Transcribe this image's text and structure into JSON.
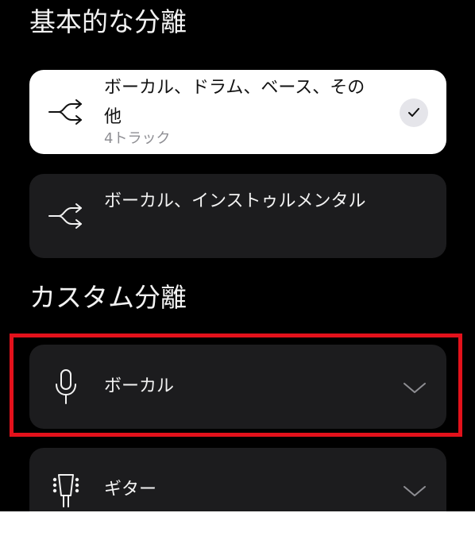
{
  "sections": {
    "basic": {
      "title": "基本的な分離"
    },
    "custom": {
      "title": "カスタム分離"
    }
  },
  "basic_options": [
    {
      "title": "ボーカル、ドラム、ベース、その他",
      "subtitle": "4トラック",
      "selected": true,
      "icon": "split-arrows-icon"
    },
    {
      "title": "ボーカル、インストゥルメンタル",
      "selected": false,
      "icon": "split-arrows-icon"
    }
  ],
  "custom_options": [
    {
      "label": "ボーカル",
      "icon": "microphone-icon",
      "expand_icon": "chevron-down-icon"
    },
    {
      "label": "ギター",
      "icon": "guitar-headstock-icon",
      "expand_icon": "chevron-down-icon"
    }
  ],
  "colors": {
    "background": "#000000",
    "card": "#1c1c1e",
    "card_selected": "#ffffff",
    "highlight_border": "#e3111b"
  }
}
